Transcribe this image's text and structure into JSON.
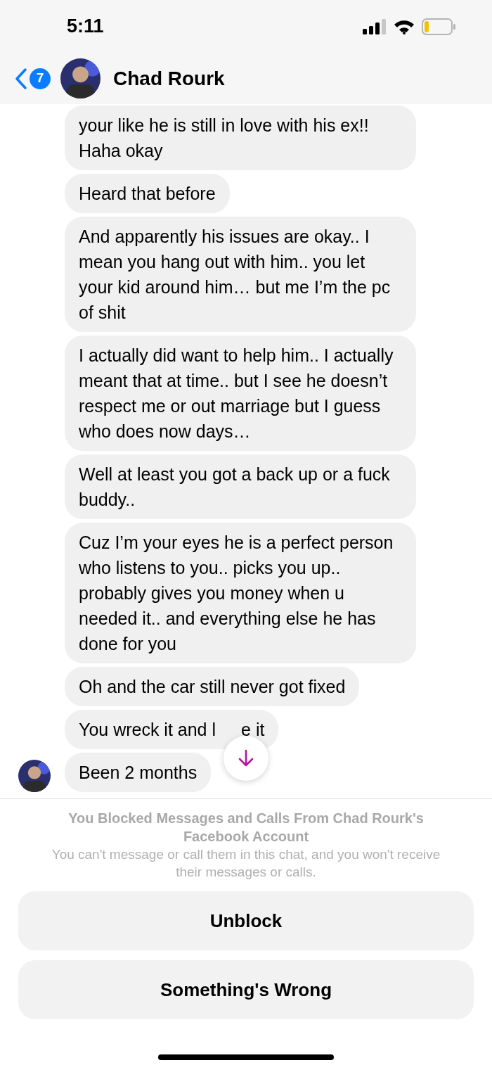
{
  "status_bar": {
    "time": "5:11"
  },
  "header": {
    "back_badge": "7",
    "name": "Chad Rourk"
  },
  "messages": [
    {
      "kind": "text",
      "text": "your like he is still in love with his ex!! Haha okay",
      "show_avatar": false
    },
    {
      "kind": "text",
      "text": "Heard that before",
      "show_avatar": false
    },
    {
      "kind": "text",
      "text": "And apparently his issues are okay.. I mean you hang out with him.. you let your kid around him… but me I’m the pc of shit",
      "show_avatar": false
    },
    {
      "kind": "text",
      "text": "I actually did want to help him.. I actually meant that at time.. but I see he doesn’t respect me or out marriage but I guess who does now days…",
      "show_avatar": false
    },
    {
      "kind": "text",
      "text": "Well at least you got a back up or a fuck buddy..",
      "show_avatar": false
    },
    {
      "kind": "text",
      "text": "Cuz I’m your eyes he is a perfect person who listens to you.. picks you up.. probably gives you money when u needed it.. and everything else he has done for you",
      "show_avatar": false
    },
    {
      "kind": "text",
      "text": "Oh and the car still never got fixed",
      "show_avatar": false
    },
    {
      "kind": "covered",
      "parts": [
        "You wreck it and l",
        "e it"
      ],
      "show_avatar": false
    },
    {
      "kind": "text",
      "text": "Been 2 months",
      "show_avatar": true
    }
  ],
  "blocked_notice": {
    "title": "You Blocked Messages and Calls From Chad Rourk's Facebook Account",
    "body": "You can't message or call them in this chat, and you won't receive their messages or calls."
  },
  "buttons": [
    "Unblock",
    "Something's Wrong"
  ]
}
